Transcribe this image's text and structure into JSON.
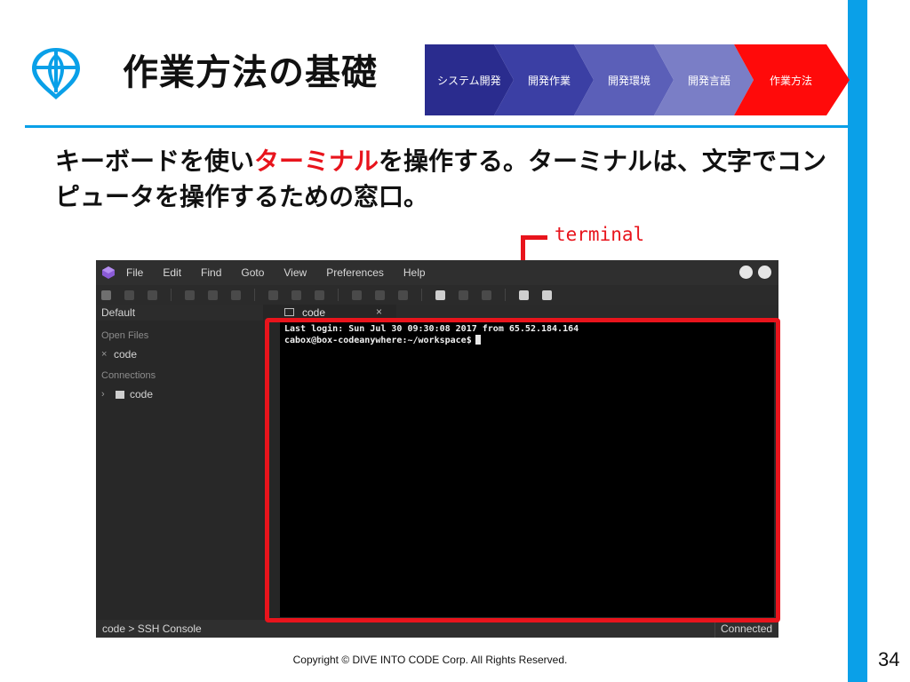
{
  "slide": {
    "title": "作業方法の基礎",
    "breadcrumb": [
      {
        "label": "システム開発",
        "color": "#2a2c8e"
      },
      {
        "label": "開発作業",
        "color": "#3b3fa4"
      },
      {
        "label": "開発環境",
        "color": "#5b5fb8"
      },
      {
        "label": "開発言語",
        "color": "#7a7ec6"
      },
      {
        "label": "作業方法",
        "color": "#ff0a0a"
      }
    ],
    "intro": {
      "before": "キーボードを使い",
      "highlight": "ターミナル",
      "after": "を操作する。ターミナルは、文字でコンピュータを操作するための窓口。"
    },
    "callout_label": "terminal",
    "copyright": "Copyright © DIVE INTO CODE Corp. All Rights Reserved.",
    "page_number": "34",
    "accent_color": "#0aa0e8",
    "highlight_color": "#e8141c"
  },
  "ide": {
    "menu": [
      "File",
      "Edit",
      "Find",
      "Goto",
      "View",
      "Preferences",
      "Help"
    ],
    "sidebar": {
      "header": "Default",
      "open_files_label": "Open Files",
      "open_file": "code",
      "connections_label": "Connections",
      "connection": "code"
    },
    "tab": {
      "label": "code"
    },
    "terminal": {
      "line1": "Last login: Sun Jul 30 09:30:08 2017 from 65.52.184.164",
      "prompt": "cabox@box-codeanywhere:~/workspace$"
    },
    "status": {
      "left": "code > SSH Console",
      "right": "Connected"
    }
  }
}
